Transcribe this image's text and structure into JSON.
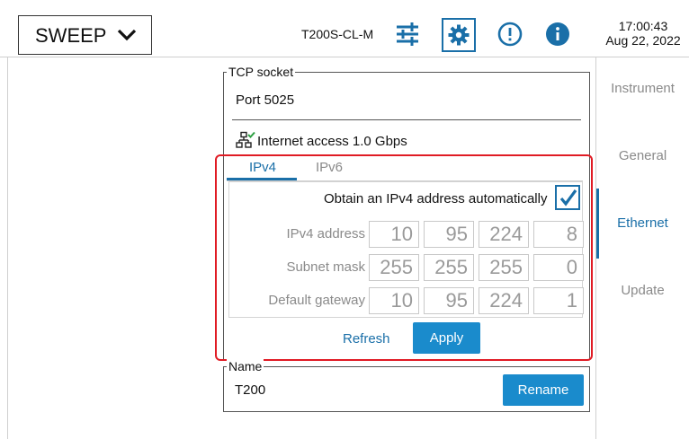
{
  "header": {
    "mode_label": "SWEEP",
    "device_name": "T200S-CL-M",
    "clock_time": "17:00:43",
    "clock_date": "Aug 22, 2022",
    "icons": [
      "chevron-down-icon",
      "sliders-icon",
      "gear-icon",
      "alert-circle-icon",
      "info-icon"
    ]
  },
  "nav": {
    "items": [
      {
        "label": "Instrument",
        "active": false
      },
      {
        "label": "General",
        "active": false
      },
      {
        "label": "Ethernet",
        "active": true
      },
      {
        "label": "Update",
        "active": false
      }
    ]
  },
  "tcp": {
    "legend": "TCP socket",
    "port_text": "Port 5025",
    "internet_text": "Internet access 1.0 Gbps"
  },
  "tabs": [
    {
      "label": "IPv4",
      "active": true
    },
    {
      "label": "IPv6",
      "active": false
    }
  ],
  "ipv4": {
    "auto_label": "Obtain an IPv4 address automatically",
    "auto_checked": true,
    "rows": [
      {
        "label": "IPv4 address",
        "octets": [
          "10",
          "95",
          "224",
          "8"
        ]
      },
      {
        "label": "Subnet mask",
        "octets": [
          "255",
          "255",
          "255",
          "0"
        ]
      },
      {
        "label": "Default gateway",
        "octets": [
          "10",
          "95",
          "224",
          "1"
        ]
      }
    ],
    "refresh_label": "Refresh",
    "apply_label": "Apply"
  },
  "name": {
    "legend": "Name",
    "value": "T200",
    "rename_label": "Rename"
  },
  "colors": {
    "accent": "#1a6fa8",
    "button": "#1a8bcc",
    "highlight": "#e01b24"
  }
}
